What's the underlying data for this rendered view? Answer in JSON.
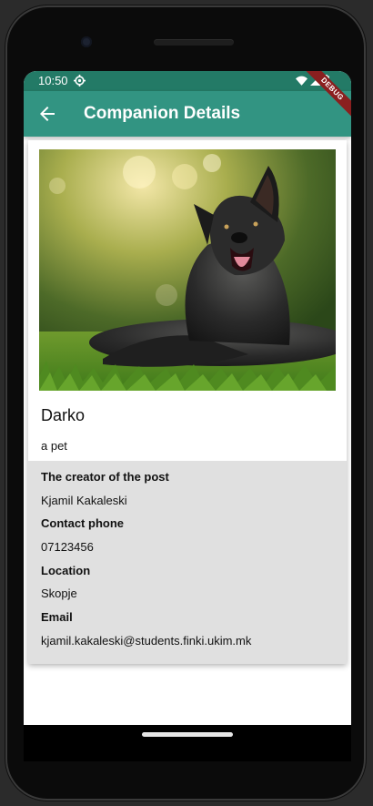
{
  "status_bar": {
    "time": "10:50",
    "icons": [
      "gear-icon",
      "wifi-icon",
      "cellular-signal-icon",
      "battery-icon"
    ]
  },
  "app_bar": {
    "title": "Companion Details",
    "back_icon": "arrow-left-icon",
    "debug_banner": "DEBUG"
  },
  "pet": {
    "image": "dog-photo",
    "name": "Darko",
    "description": "a pet"
  },
  "details": {
    "creator_label": "The creator of the post",
    "creator_value": "Kjamil Kakaleski",
    "phone_label": "Contact phone",
    "phone_value": "07123456",
    "location_label": "Location",
    "location_value": "Skopje",
    "email_label": "Email",
    "email_value": "kjamil.kakaleski@students.finki.ukim.mk"
  },
  "colors": {
    "app_bar": "#329482",
    "status_bar": "#237a66",
    "info_panel": "#e0e0e0"
  }
}
